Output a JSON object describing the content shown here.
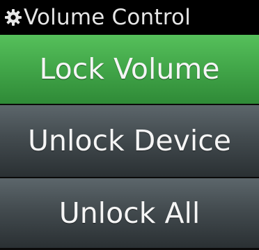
{
  "header": {
    "title": "Volume Control",
    "icon": "gear-icon"
  },
  "menu": {
    "items": [
      {
        "label": "Lock Volume",
        "selected": true
      },
      {
        "label": "Unlock Device",
        "selected": false
      },
      {
        "label": "Unlock All",
        "selected": false
      }
    ]
  },
  "colors": {
    "selected": "#43a84a",
    "normal": "#434b4f",
    "header_bg": "#000000",
    "text": "#f5f5f5"
  }
}
